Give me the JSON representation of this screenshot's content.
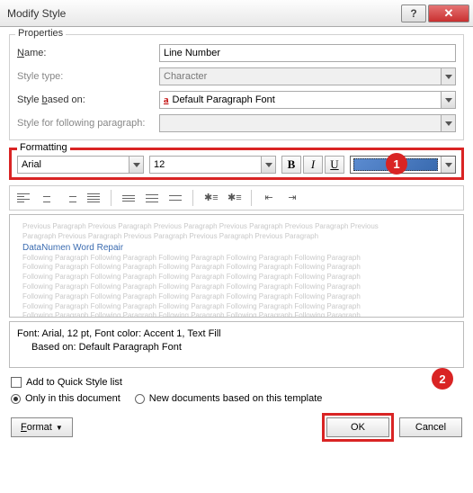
{
  "title": "Modify Style",
  "properties": {
    "label": "Properties",
    "name_label": "Name:",
    "name_value": "Line Number",
    "type_label": "Style type:",
    "type_value": "Character",
    "based_label": "Style based on:",
    "based_value": "Default Paragraph Font",
    "follow_label": "Style for following paragraph:",
    "follow_value": ""
  },
  "formatting": {
    "label": "Formatting",
    "font": "Arial",
    "size": "12",
    "bold": "B",
    "italic": "I",
    "underline": "U"
  },
  "callouts": {
    "one": "1",
    "two": "2"
  },
  "preview": {
    "prev_text": "Previous Paragraph Previous Paragraph Previous Paragraph Previous Paragraph Previous Paragraph Previous",
    "prev_text2": "Paragraph Previous Paragraph Previous Paragraph Previous Paragraph Previous Paragraph",
    "sample": "DataNumen Word Repair",
    "follow_text": "Following Paragraph Following Paragraph Following Paragraph Following Paragraph Following Paragraph"
  },
  "description": {
    "line1": "Font: Arial, 12 pt, Font color: Accent 1, Text Fill",
    "line2": "Based on: Default Paragraph Font"
  },
  "options": {
    "addquick": "Add to Quick Style list",
    "onlydoc": "Only in this document",
    "newdocs": "New documents based on this template"
  },
  "footer": {
    "format": "Format",
    "ok": "OK",
    "cancel": "Cancel"
  }
}
